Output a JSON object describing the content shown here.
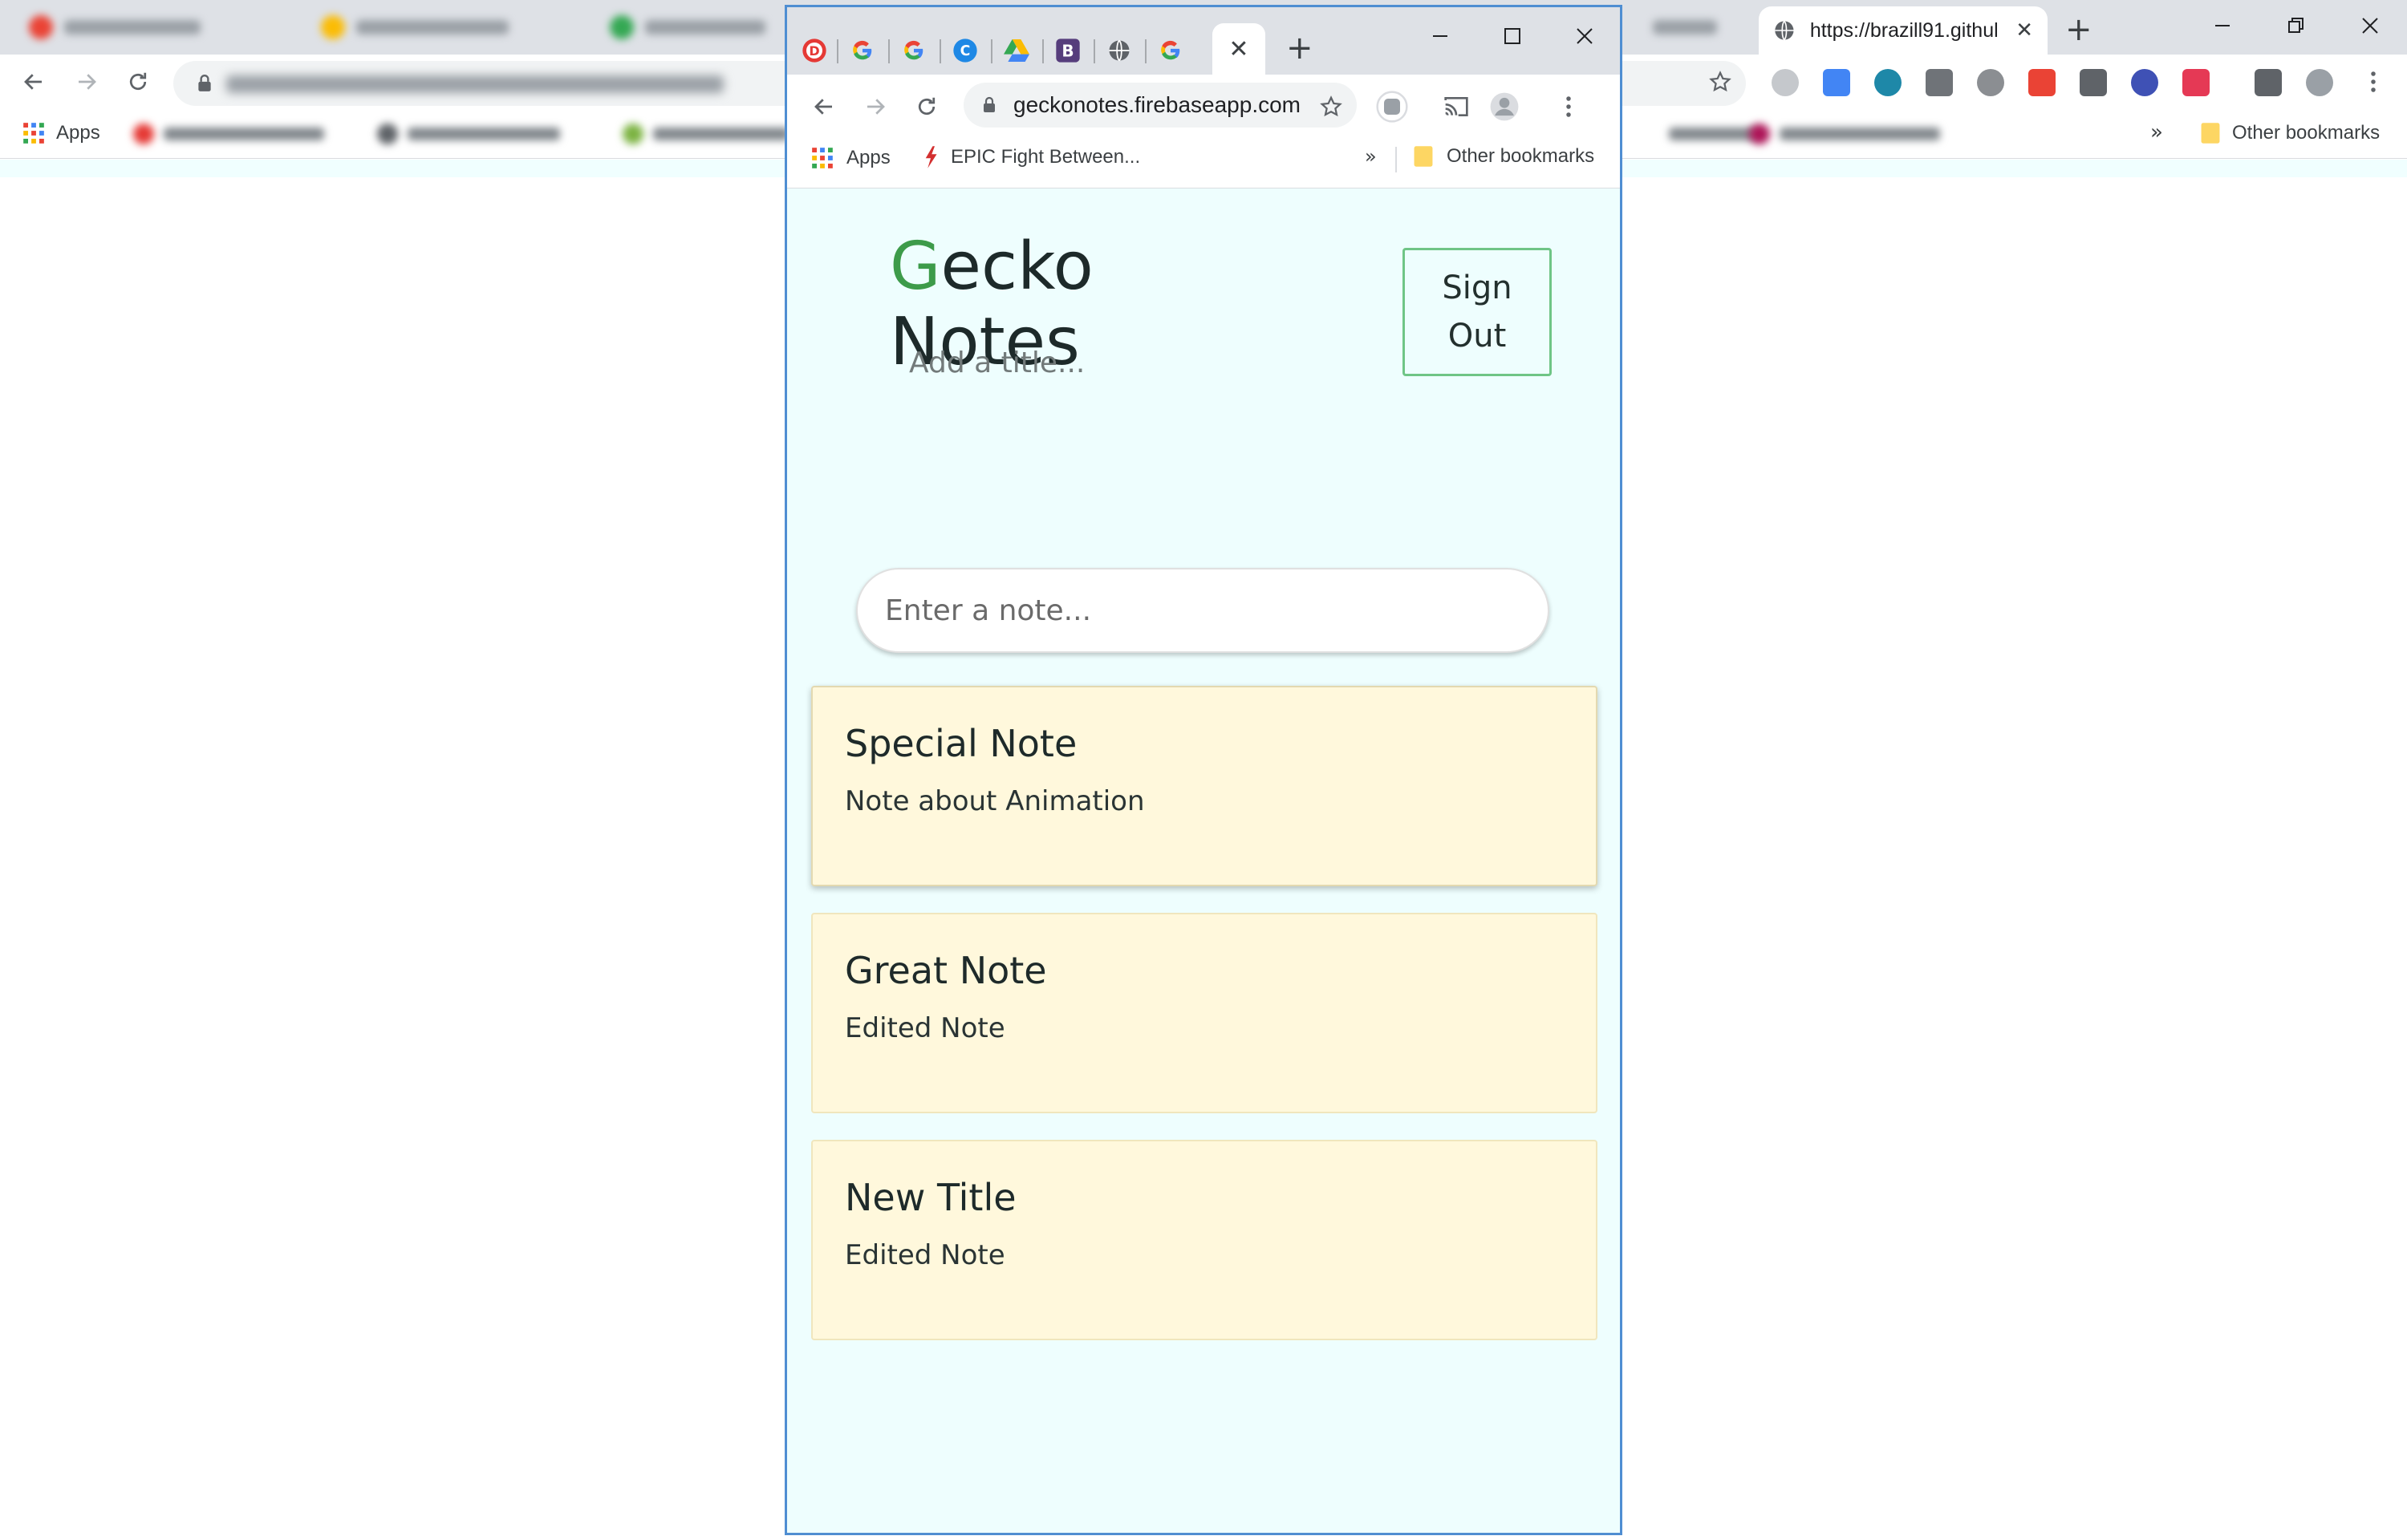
{
  "background_browser": {
    "active_tab_title": "https://brazill91.githul",
    "apps_label": "Apps",
    "other_bookmarks_label": "Other bookmarks",
    "more_bookmarks_glyph": "»",
    "new_tab_glyph": "+",
    "close_tab_glyph": "✕"
  },
  "popup_browser": {
    "url": "geckonotes.firebaseapp.com",
    "active_tab_close_glyph": "✕",
    "new_tab_glyph": "+",
    "bookmarks": {
      "apps_label": "Apps",
      "epic_label": "EPIC Fight Between...",
      "more_glyph": "»",
      "other_label": "Other bookmarks"
    }
  },
  "app": {
    "logo_first_letter": "G",
    "logo_rest_line1": "ecko",
    "logo_line2": "Notes",
    "sign_out_line1": "Sign",
    "sign_out_line2": "Out",
    "title_placeholder": "Add a title...",
    "note_placeholder": "Enter a note...",
    "notes": [
      {
        "title": "Special Note",
        "body": "Note about Animation"
      },
      {
        "title": "Great Note",
        "body": "Edited Note"
      },
      {
        "title": "New Title",
        "body": "Edited Note"
      }
    ]
  },
  "colors": {
    "app_background": "#eefefe",
    "logo_accent": "#3d9b4a",
    "sign_out_border": "#6fc586",
    "note_card": "#fff8dc",
    "popup_border": "#4f8ed2"
  }
}
